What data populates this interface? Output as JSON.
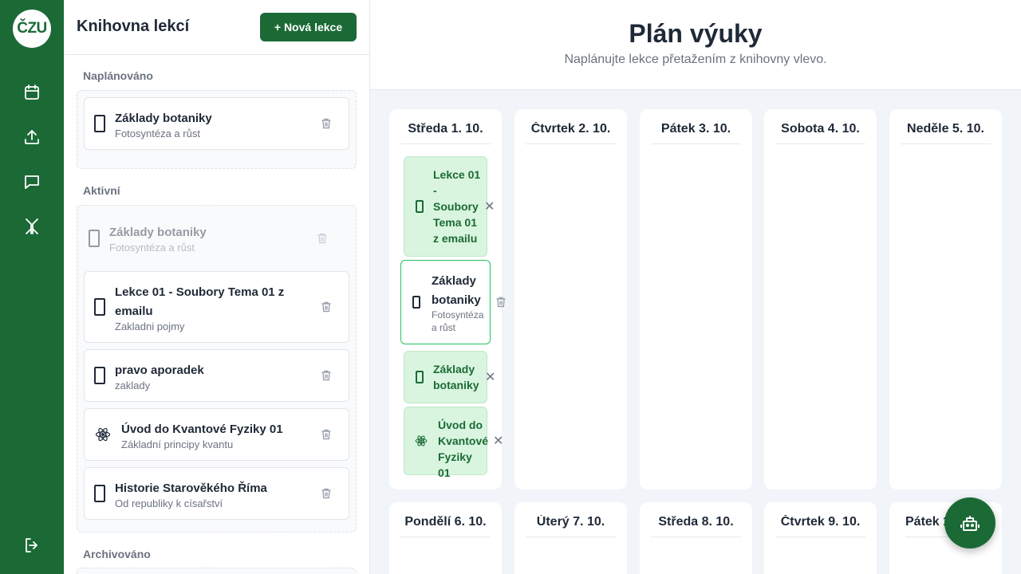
{
  "brand": {
    "logo_text": "ČZU",
    "accent": "#1b6a36"
  },
  "rail": {
    "items": [
      "calendar-icon",
      "upload-icon",
      "chat-icon",
      "hub-icon"
    ],
    "logout": "logout-icon"
  },
  "library": {
    "title": "Knihovna lekcí",
    "new_button": "+ Nová lekce",
    "sections": {
      "planned": {
        "label": "Naplánováno",
        "items": [
          {
            "title": "Základy botaniky",
            "subtitle": "Fotosyntéza a růst",
            "icon": "document-icon"
          }
        ]
      },
      "active": {
        "label": "Aktivní",
        "items": [
          {
            "title": "Základy botaniky",
            "subtitle": "Fotosyntéza a růst",
            "icon": "document-icon",
            "ghost": true
          },
          {
            "title": "Lekce 01 - Soubory Tema 01 z",
            "title2": "emailu",
            "subtitle": "Zakladni pojmy",
            "icon": "document-icon"
          },
          {
            "title": "pravo aporadek",
            "subtitle": "zaklady",
            "icon": "document-icon"
          },
          {
            "title": "Úvod do Kvantové Fyziky 01",
            "subtitle": "Základní principy kvantu",
            "icon": "atom-icon"
          },
          {
            "title": "Historie Starověkého Říma",
            "subtitle": "Od republiky k císařství",
            "icon": "document-icon"
          }
        ]
      },
      "archived": {
        "label": "Archivováno"
      }
    }
  },
  "plan": {
    "title": "Plán výuky",
    "subtitle": "Naplánujte lekce přetažením z knihovny vlevo.",
    "days_row1": [
      "Středa 1. 10.",
      "Čtvrtek 2. 10.",
      "Pátek 3. 10.",
      "Sobota 4. 10.",
      "Neděle 5. 10."
    ],
    "days_row2": [
      "Pondělí 6. 10.",
      "Úterý 7. 10.",
      "Středa 8. 10.",
      "Čtvrtek 9. 10.",
      "Pátek 10. 10."
    ],
    "day1_items": {
      "lesson01": [
        "Lekce 01",
        "-",
        "Soubory",
        "Tema 01",
        "z emailu"
      ],
      "dragging": {
        "lines": [
          "Základy",
          "botaniky"
        ],
        "subtitle_lines": [
          "Fotosyntéza",
          "a růst"
        ]
      },
      "botanika": [
        "Základy",
        "botaniky"
      ],
      "kvant": [
        "Úvod do",
        "Kvantové",
        "Fyziky 01"
      ],
      "remove_symbol": "✕"
    }
  },
  "fab": {
    "icon": "robot-icon"
  }
}
